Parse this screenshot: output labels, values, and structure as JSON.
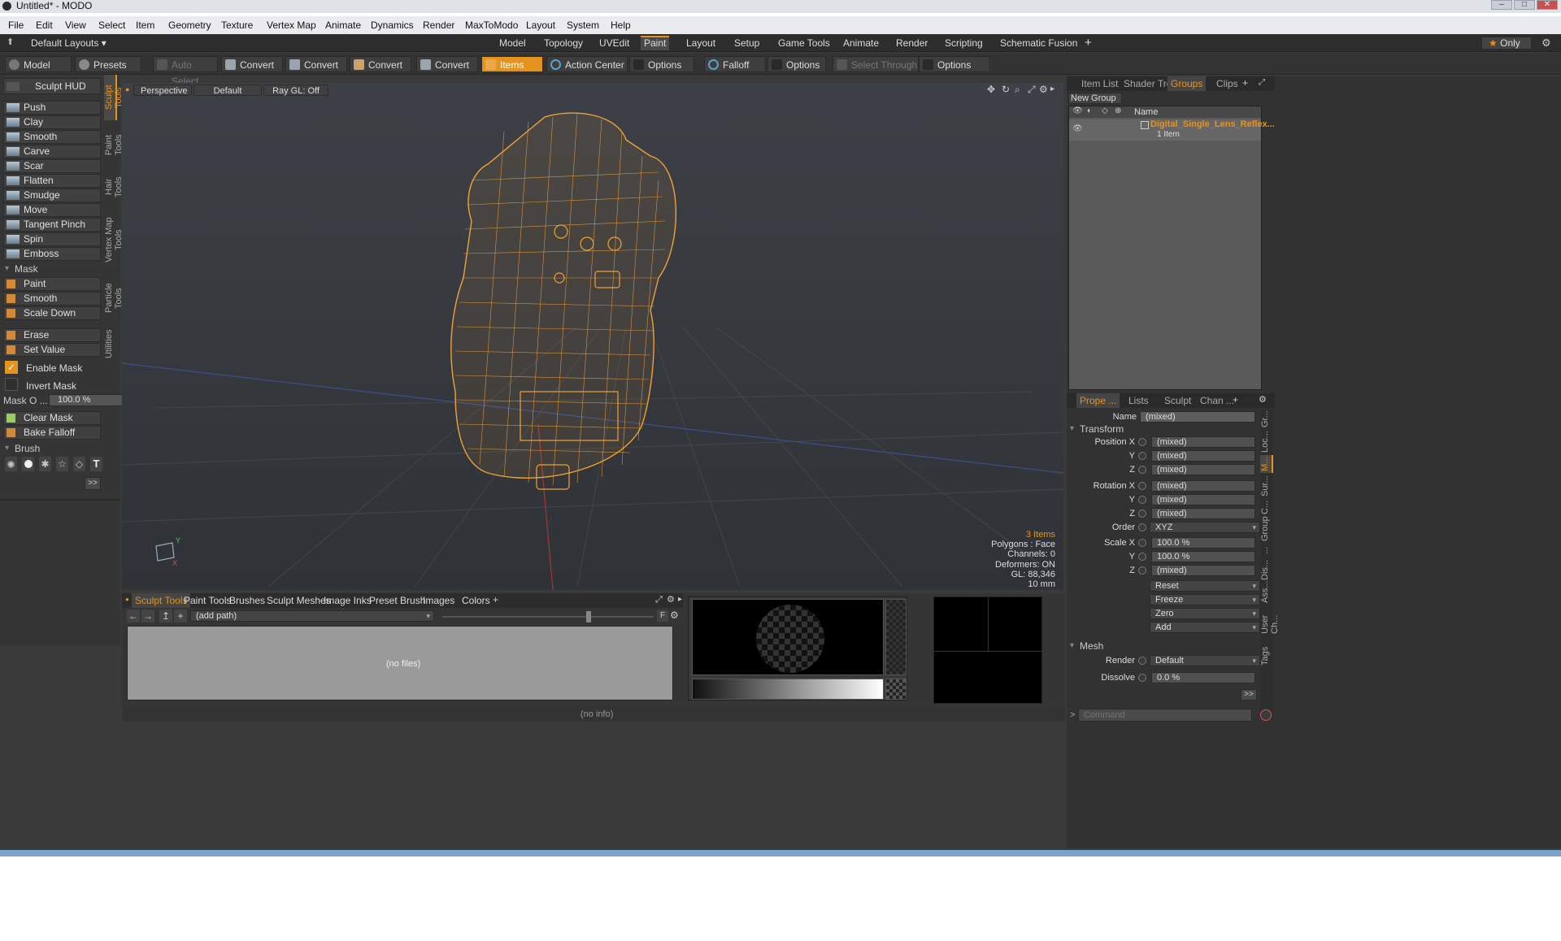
{
  "window": {
    "title": "Untitled* - MODO"
  },
  "menu": [
    "File",
    "Edit",
    "View",
    "Select",
    "Item",
    "Geometry",
    "Texture",
    "Vertex Map",
    "Animate",
    "Dynamics",
    "Render",
    "MaxToModo",
    "Layout",
    "System",
    "Help"
  ],
  "layout_selector": "Default Layouts",
  "layout_tabs": [
    "Model",
    "Topology",
    "UVEdit",
    "Paint",
    "Layout",
    "Setup",
    "Game Tools",
    "Animate",
    "Render",
    "Scripting",
    "Schematic Fusion"
  ],
  "active_layout_tab": "Paint",
  "only_label": "Only",
  "toolbar": {
    "model": "Model",
    "model_key": "F2",
    "presets": "Presets",
    "presets_key": "F6",
    "auto_select": "Auto Select",
    "convert": "Convert",
    "items": "Items",
    "action_center": "Action Center",
    "options": "Options",
    "falloff": "Falloff",
    "select_through": "Select Through"
  },
  "sculpt": {
    "hud": "Sculpt HUD",
    "tools": [
      "Push",
      "Clay",
      "Smooth",
      "Carve",
      "Scar",
      "Flatten",
      "Smudge",
      "Move",
      "Tangent Pinch",
      "Spin",
      "Emboss"
    ],
    "mask_header": "Mask",
    "mask_tools": [
      "Paint",
      "Smooth",
      "Scale Down"
    ],
    "erase": "Erase",
    "set_value": "Set Value",
    "enable_mask": "Enable Mask",
    "invert_mask": "Invert Mask",
    "mask_opacity_label": "Mask O ...",
    "mask_opacity_value": "100.0 %",
    "clear_mask": "Clear Mask",
    "bake_falloff": "Bake Falloff",
    "brush_header": "Brush",
    "more": ">>"
  },
  "vertical_tabs": [
    "Sculpt Tools",
    "Paint Tools",
    "Hair Tools",
    "Vertex Map Tools",
    "Particle Tools",
    "Utilities"
  ],
  "viewport": {
    "perspective": "Perspective",
    "default": "Default",
    "raygl": "Ray GL: Off",
    "stats": {
      "items": "3 Items",
      "polygons": "Polygons : Face",
      "channels": "Channels: 0",
      "deformers": "Deformers: ON",
      "gl": "GL: 88,346",
      "unit": "10 mm"
    }
  },
  "bottom_tabs": [
    "Sculpt Tools",
    "Paint Tools",
    "Brushes",
    "Sculpt Meshes",
    "Image Inks",
    "Preset Brush",
    "Images",
    "Colors"
  ],
  "bottom": {
    "path": "(add path)",
    "no_files": "(no files)",
    "f_label": "F"
  },
  "status": {
    "no_info": "(no info)"
  },
  "groups_panel": {
    "tabs": [
      "Item List",
      "Shader Tree",
      "Groups",
      "Clips"
    ],
    "active": "Groups",
    "new_group": "New Group",
    "name_header": "Name",
    "group_name": "Digital_Single_Lens_Reflex...",
    "group_count": "1 Item"
  },
  "properties": {
    "tabs": [
      "Prope ...",
      "Lists",
      "Sculpt",
      "Chan ..."
    ],
    "name_label": "Name",
    "name_value": "(mixed)",
    "transform": "Transform",
    "position": [
      [
        "Position X",
        "(mixed)"
      ],
      [
        "Y",
        "(mixed)"
      ],
      [
        "Z",
        "(mixed)"
      ]
    ],
    "rotation": [
      [
        "Rotation X",
        "(mixed)"
      ],
      [
        "Y",
        "(mixed)"
      ],
      [
        "Z",
        "(mixed)"
      ]
    ],
    "order_label": "Order",
    "order_value": "XYZ",
    "scale": [
      [
        "Scale X",
        "100.0 %"
      ],
      [
        "Y",
        "100.0 %"
      ],
      [
        "Z",
        "(mixed)"
      ]
    ],
    "actions": [
      "Reset",
      "Freeze",
      "Zero",
      "Add"
    ],
    "mesh": "Mesh",
    "render_label": "Render",
    "render_value": "Default",
    "dissolve_label": "Dissolve",
    "dissolve_value": "0.0 %",
    "more": ">>",
    "side_tabs": [
      "Gr...",
      "Loc...",
      "M...",
      "Sur...",
      "C...",
      "Group",
      "...",
      "Dis...",
      "Ass...",
      "User Ch...",
      "Tags"
    ]
  },
  "command": {
    "prompt": ">",
    "placeholder": "Command"
  },
  "colors": {
    "accent": "#e5931f",
    "wire": "#f0a23a"
  }
}
